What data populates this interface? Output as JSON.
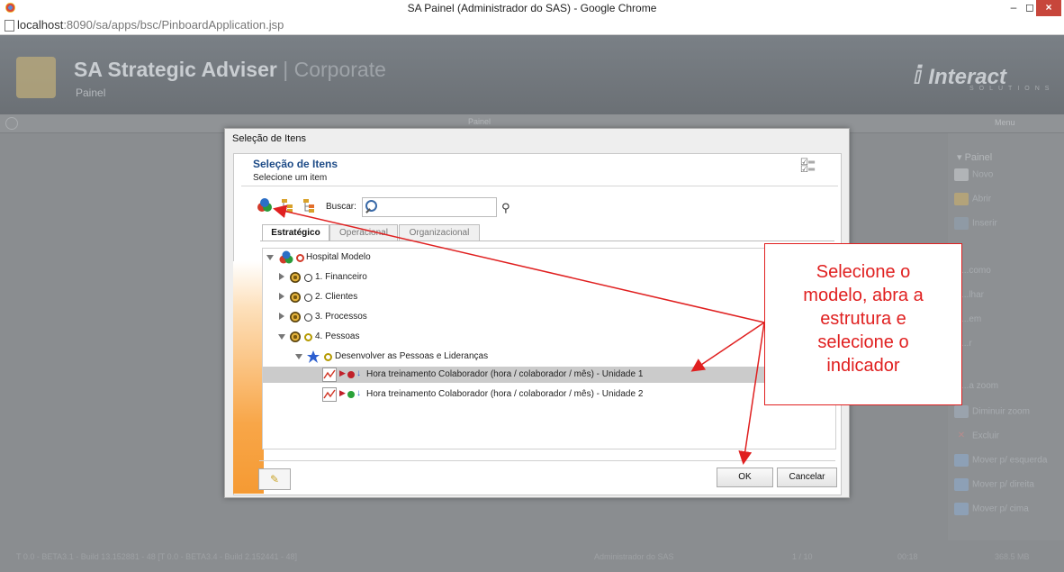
{
  "window": {
    "title": "SA Painel (Administrador do SAS) - Google Chrome",
    "min": "–",
    "max": "◻",
    "close": "×"
  },
  "browser": {
    "url_host": "localhost",
    "url_rest": ":8090/sa/apps/bsc/PinboardApplication.jsp"
  },
  "app": {
    "title": "SA Strategic Adviser",
    "separator": " | ",
    "edition": "Corporate",
    "subtitle": "Painel",
    "brand": "Interact",
    "brand_sub": "SOLUTIONS",
    "panel_label": "Painel",
    "menu_label": "Menu"
  },
  "sidebar": {
    "header": "Painel",
    "items": [
      "Novo",
      "Abrir",
      "Inserir",
      "...como",
      "...lhar",
      "...em",
      "...r",
      "...a zoom",
      "Diminuir zoom",
      "Excluir",
      "Mover p/ esquerda",
      "Mover p/ direita",
      "Mover p/ cima"
    ]
  },
  "status": {
    "build": "T 0.0 - BETA3.1 - Build 13.152881 - 48 [T 0.0 - BETA3.4 - Build 2.152441 - 48]",
    "user": "Administrador do SAS",
    "page": "1 / 10",
    "time": "00:18",
    "memory": "368.5 MB"
  },
  "dialog": {
    "window_title": "Seleção de Itens",
    "header_title": "Seleção de Itens",
    "header_subtitle": "Selecione um item",
    "search_label": "Buscar:",
    "search_value": "",
    "tabs": [
      "Estratégico",
      "Operacional",
      "Organizacional"
    ],
    "tree": [
      {
        "label": "Hospital Modelo",
        "level": 0,
        "expanded": true
      },
      {
        "label": "1. Financeiro",
        "level": 1,
        "expanded": false
      },
      {
        "label": "2. Clientes",
        "level": 1,
        "expanded": false
      },
      {
        "label": "3. Processos",
        "level": 1,
        "expanded": false
      },
      {
        "label": "4. Pessoas",
        "level": 1,
        "expanded": true
      },
      {
        "label": "Desenvolver as Pessoas e Lideranças",
        "level": 2,
        "expanded": true
      },
      {
        "label": "Hora treinamento Colaborador (hora / colaborador / mês) - Unidade 1",
        "level": 3,
        "selected": true,
        "status_color": "#c0202a"
      },
      {
        "label": "Hora treinamento Colaborador (hora / colaborador / mês) - Unidade 2",
        "level": 3,
        "selected": false,
        "status_color": "#2aa23a"
      }
    ],
    "ok_label": "OK",
    "cancel_label": "Cancelar"
  },
  "annotation": {
    "lines": [
      "Selecione o",
      "modelo, abra a",
      "estrutura e",
      "selecione o",
      "indicador"
    ],
    "color": "#e02020"
  }
}
